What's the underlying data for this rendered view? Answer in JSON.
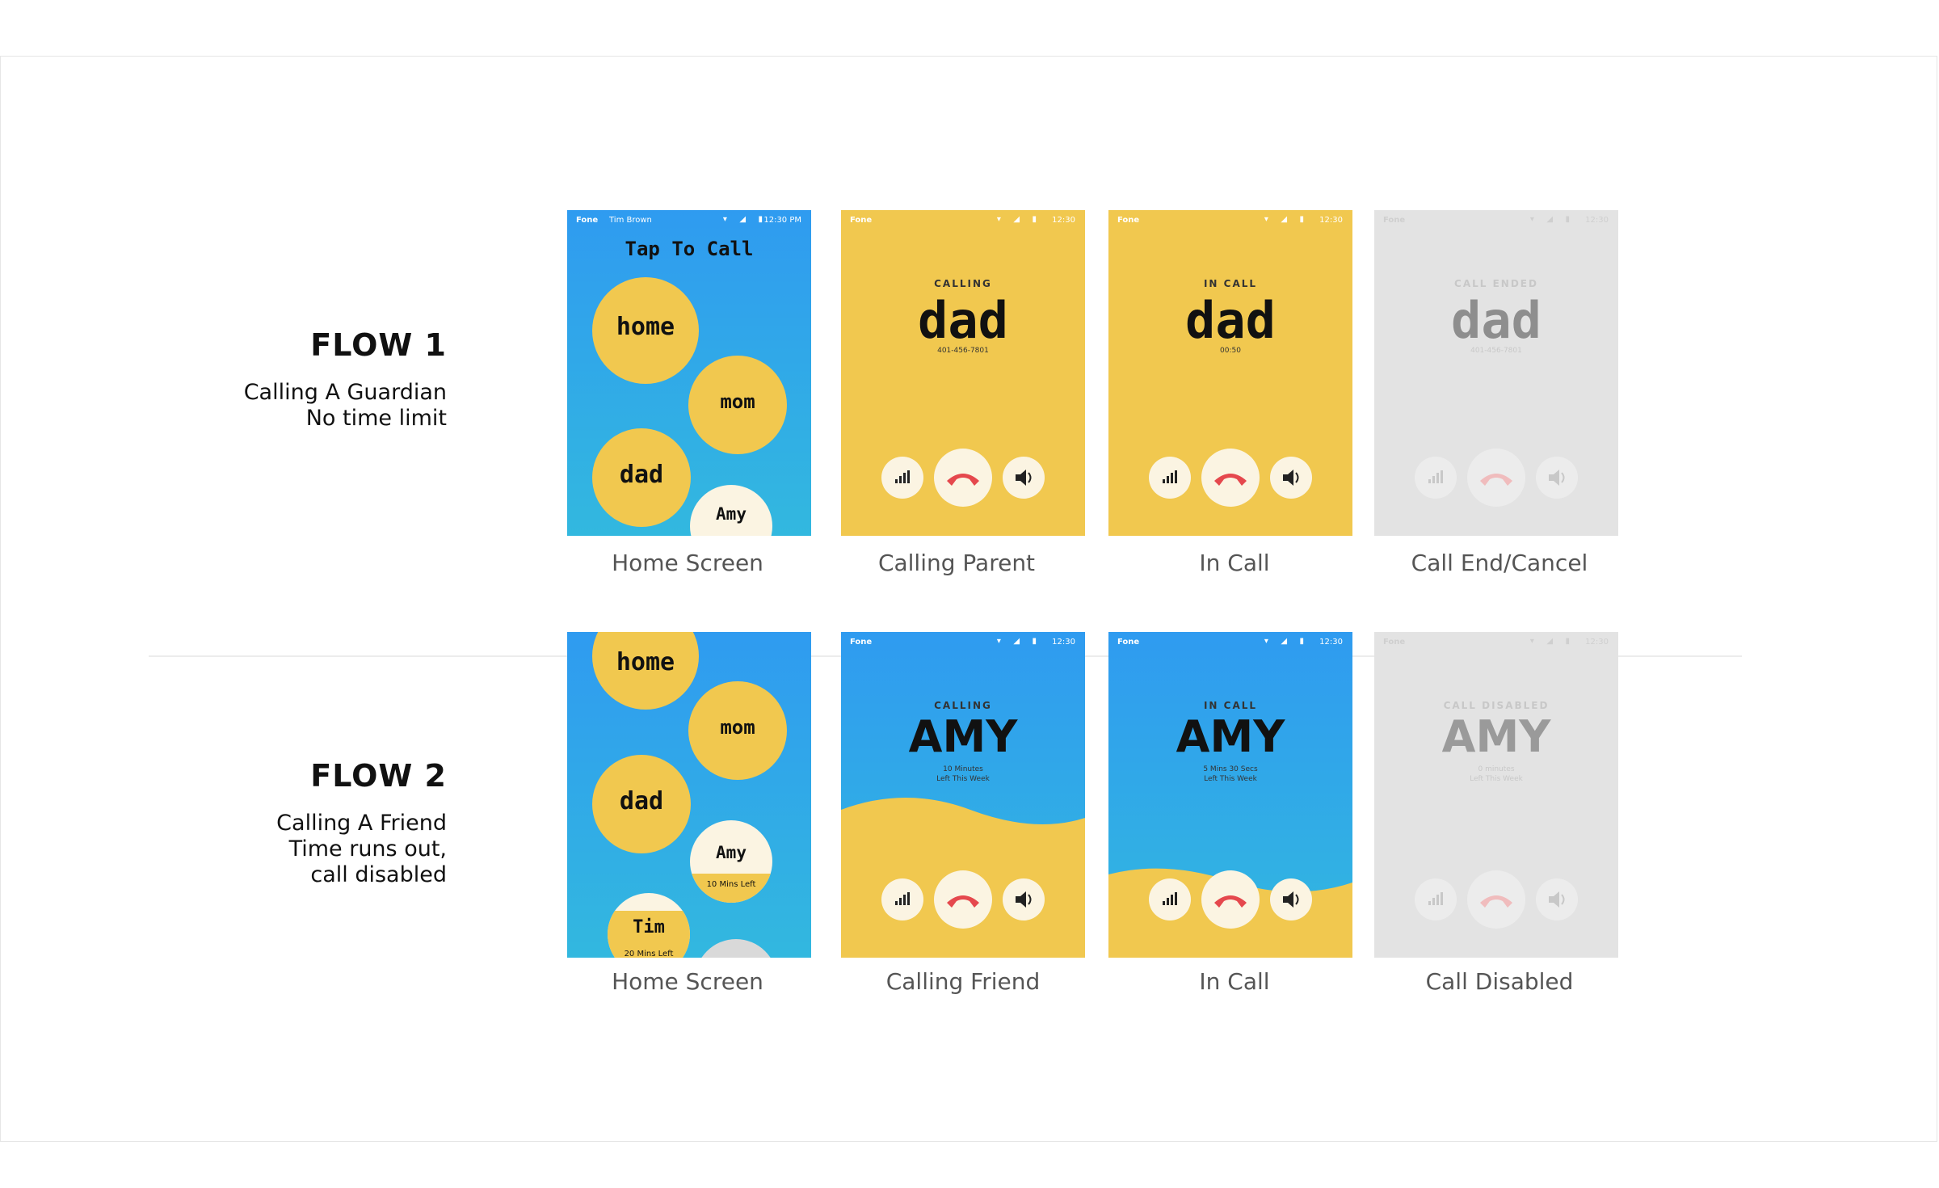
{
  "flows": [
    {
      "title": "FLOW 1",
      "desc": [
        "Calling A Guardian",
        "No time limit"
      ]
    },
    {
      "title": "FLOW 2",
      "desc": [
        "Calling A Friend",
        "Time runs out,",
        "call disabled"
      ]
    }
  ],
  "status": {
    "app": "Fone",
    "user": "Tim Brown",
    "time_full": "12:30 PM",
    "time": "12:30"
  },
  "home": {
    "title": "Tap To Call",
    "contacts": [
      "home",
      "mom",
      "dad",
      "Amy",
      "Tim"
    ],
    "amy_left": "10 Mins Left",
    "tim_left": "20 Mins Left"
  },
  "flow1_screens": [
    {
      "caption": "Home Screen"
    },
    {
      "caption": "Calling Parent",
      "label": "CALLING",
      "name": "dad",
      "sub": "401-456-7801"
    },
    {
      "caption": "In Call",
      "label": "IN CALL",
      "name": "dad",
      "sub": "00:50"
    },
    {
      "caption": "Call End/Cancel",
      "label": "CALL ENDED",
      "name": "dad",
      "sub": "401-456-7801"
    }
  ],
  "flow2_screens": [
    {
      "caption": "Home Screen"
    },
    {
      "caption": "Calling Friend",
      "label": "CALLING",
      "name": "AMY",
      "sub1": "10 Minutes",
      "sub2": "Left This Week"
    },
    {
      "caption": "In Call",
      "label": "IN CALL",
      "name": "AMY",
      "sub1": "5 Mins 30 Secs",
      "sub2": "Left This Week"
    },
    {
      "caption": "Call Disabled",
      "label": "CALL DISABLED",
      "name": "AMY",
      "sub1": "0 minutes",
      "sub2": "Left This Week"
    }
  ],
  "colors": {
    "blue": "#2f9bf0",
    "yellow": "#f1c84f",
    "cream": "#fbf4e2",
    "grey": "#e3e3e3",
    "hangup": "#e5484d"
  },
  "icons": [
    "signal-icon",
    "hangup-icon",
    "speaker-icon",
    "wifi-icon",
    "battery-icon"
  ]
}
